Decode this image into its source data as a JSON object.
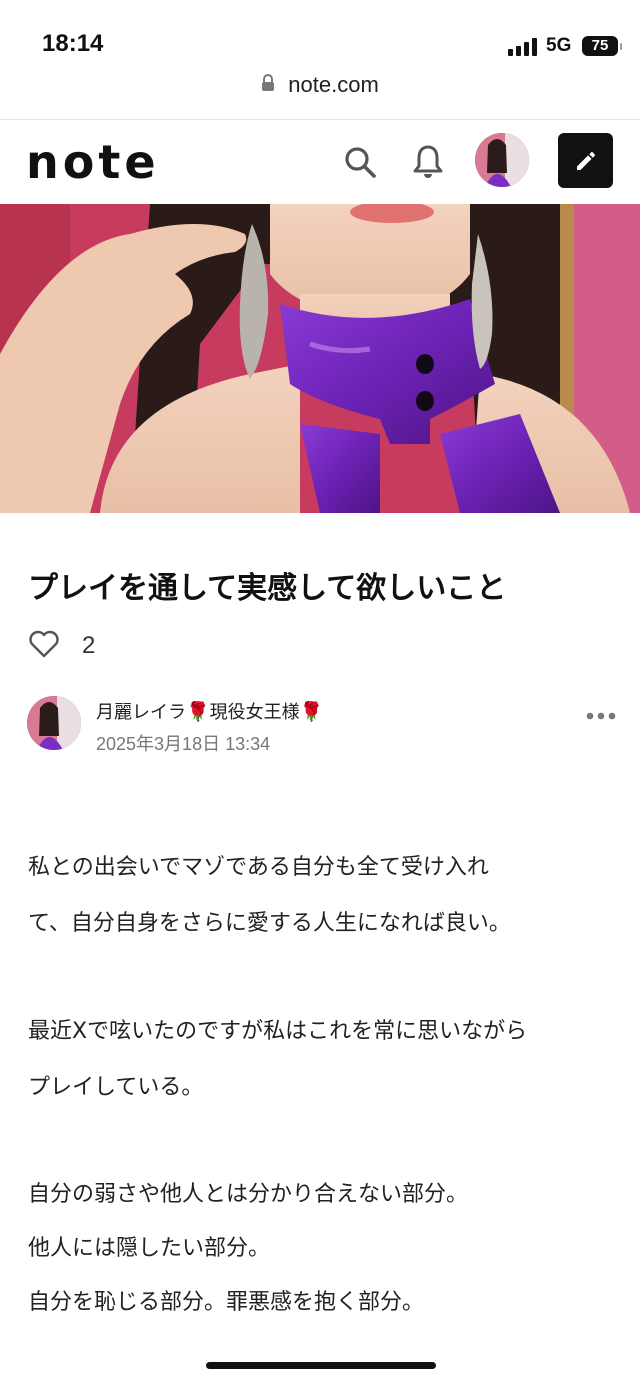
{
  "status_bar": {
    "time": "18:14",
    "network": "5G",
    "battery": "75"
  },
  "browser": {
    "url": "note.com"
  },
  "header": {
    "logo": "note",
    "icons": [
      "search-icon",
      "bell-icon",
      "pencil-icon"
    ]
  },
  "article": {
    "title": "プレイを通して実感して欲しいこと",
    "like_count": "2",
    "author": {
      "name": "月麗レイラ",
      "rose1": "🌹",
      "role": "現役女王様",
      "rose2": "🌹",
      "date": "2025年3月18日 13:34"
    },
    "paragraphs": {
      "p1_l1": "私との出会いでマゾである自分も全て受け入れ",
      "p1_l2": "て、自分自身をさらに愛する人生になれば良い。",
      "p2_l1": "最近Xで呟いたのですが私はこれを常に思いながら",
      "p2_l2": "プレイしている。",
      "p3_l1": "自分の弱さや他人とは分かり合えない部分。",
      "p3_l2": "他人には隠したい部分。",
      "p3_l3": "自分を恥じる部分。罪悪感を抱く部分。"
    }
  },
  "colors": {
    "accent": "#111111",
    "hero_top": "#c23a5a",
    "collar": "#7b2fc2"
  }
}
